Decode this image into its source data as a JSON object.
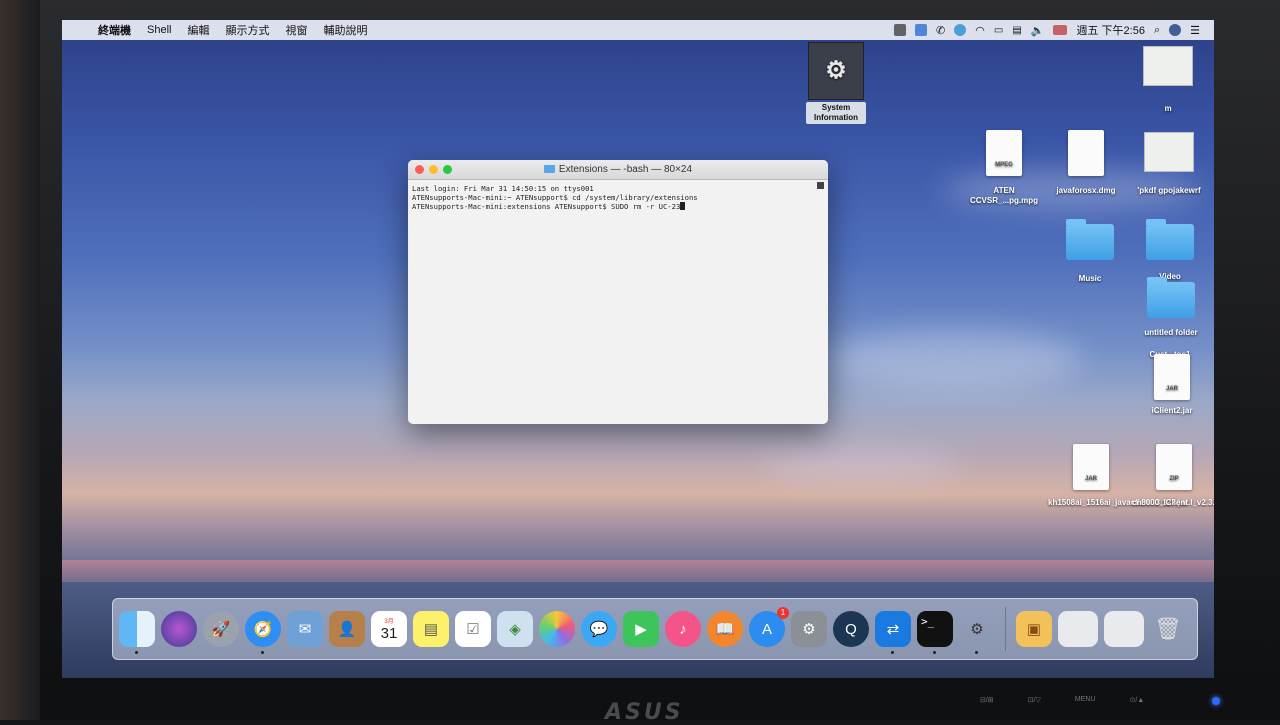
{
  "menubar": {
    "app_name": "終端機",
    "menus": [
      "Shell",
      "編輯",
      "顯示方式",
      "視窗",
      "輔助說明"
    ],
    "clock": "週五 下午2:56"
  },
  "terminal": {
    "title": "Extensions — -bash — 80×24",
    "lines": [
      "Last login: Fri Mar 31 14:50:15 on ttys001",
      "ATENsupports-Mac-mini:~ ATENsupport$ cd /system/library/extensions",
      "ATENsupports-Mac-mini:extensions ATENsupport$ SUDO rm -r UC-23"
    ]
  },
  "desktop_icons": {
    "system_information": "System Information",
    "m": "m",
    "aten_mpeg": "ATEN CCVSR_...pg.mpg",
    "mpeg_tag": "MPEG",
    "javaforosx": "javaforosx.dmg",
    "pkdf": "'pkdf gpojakewrf",
    "music": "Music",
    "video": "Video",
    "untitled_folder": "untitled folder",
    "custom_photos": "Cust...tos1",
    "iclient2": "iClient2.jar",
    "jar_tag": "JAR",
    "kh1508": "kh1508ai_1516ai_javaclien...3.127.jar",
    "cn8000": "cn8000_iClient.l_v2.3.227.zip",
    "zip_tag": "ZIP"
  },
  "dock": {
    "calendar_month": "3月",
    "calendar_day": "31",
    "appstore_badge": "1"
  },
  "monitor": {
    "brand": "ASUS",
    "buttons": [
      "⊟/⊞",
      "⊡/▽",
      "MENU",
      "⊙/▲"
    ]
  }
}
